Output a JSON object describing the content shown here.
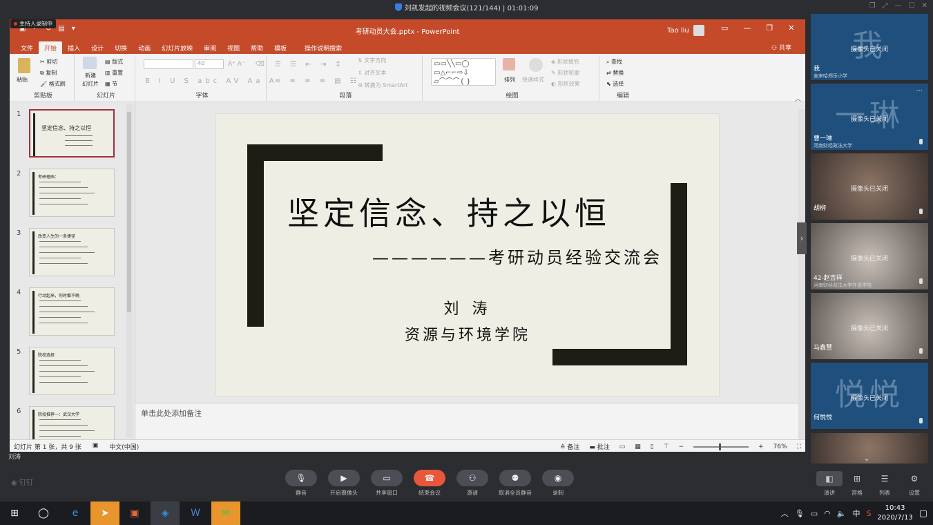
{
  "meeting": {
    "title": "刘凯发起的视频会议(121/144)  |  01:01:09",
    "recording_badge": "主持人录制中",
    "presenter_name": "刘涛"
  },
  "ppt": {
    "doc_title": "考研动员大会.pptx  -  PowerPoint",
    "user_name": "Tao liu",
    "share_label": "共享",
    "tabs": [
      "文件",
      "开始",
      "插入",
      "设计",
      "切换",
      "动画",
      "幻灯片放映",
      "审阅",
      "视图",
      "帮助",
      "模板",
      "操作说明搜索"
    ],
    "active_tab": "开始",
    "ribbon": {
      "clipboard": {
        "label": "剪贴板",
        "paste": "粘贴",
        "cut": "剪切",
        "copy": "复制",
        "format_painter": "格式刷"
      },
      "slides": {
        "label": "幻灯片",
        "new_slide": "新建\n幻灯片",
        "layout": "版式",
        "reset": "重置",
        "section": "节"
      },
      "font": {
        "label": "字体",
        "size": "40"
      },
      "paragraph": {
        "label": "段落",
        "text_direction": "文字方向",
        "align_text": "对齐文本",
        "smartart": "转换为 SmartArt"
      },
      "drawing": {
        "label": "绘图",
        "arrange": "排列",
        "quick_styles": "快速样式",
        "shape_fill": "形状填充",
        "shape_outline": "形状轮廓",
        "shape_effects": "形状效果"
      },
      "editing": {
        "label": "编辑",
        "find": "查找",
        "replace": "替换",
        "select": "选择"
      }
    },
    "thumbnails": [
      {
        "num": "1",
        "title": "坚定信念、持之以恒"
      },
      {
        "num": "2",
        "title": "考研理由："
      },
      {
        "num": "3",
        "title": "改变人生的一条捷径"
      },
      {
        "num": "4",
        "title": "行动起来，何时都不晚"
      },
      {
        "num": "5",
        "title": "院校选择"
      },
      {
        "num": "6",
        "title": "院校推荐一：武汉大学"
      }
    ],
    "slide": {
      "title": "坚定信念、持之以恒",
      "subtitle": "——————考研动员经验交流会",
      "author": "刘 涛",
      "institute": "资源与环境学院"
    },
    "notes_placeholder": "单击此处添加备注",
    "status": {
      "slide_info": "幻灯片 第 1 张，共 9 张",
      "language": "中文(中国)",
      "notes_btn": "备注",
      "comments_btn": "批注",
      "zoom": "76%"
    }
  },
  "participants": [
    {
      "big": "我",
      "cam": "摄像头已关闭",
      "name": "我",
      "org": "舍宋哈郑乐小学",
      "style": "blue"
    },
    {
      "big": "一琳",
      "cam": "摄像头已关闭",
      "name": "曹一琳",
      "org": "河南财经政法大学",
      "style": "blue"
    },
    {
      "big": "",
      "cam": "摄像头已关闭",
      "name": "胡柳",
      "org": "",
      "style": "photo"
    },
    {
      "big": "",
      "cam": "摄像头已关闭",
      "name": "42-赵吉祥",
      "org": "河南财经政法大学外语学院",
      "style": "photo2"
    },
    {
      "big": "",
      "cam": "摄像头已关闭",
      "name": "马鑫慧",
      "org": "",
      "style": "photo2"
    },
    {
      "big": "悦悦",
      "cam": "摄像头已关闭",
      "name": "何悦悦",
      "org": "",
      "style": "blue"
    }
  ],
  "toolbar": {
    "brand": "钉钉",
    "mute": "静音",
    "camera": "开启摄像头",
    "share": "共享窗口",
    "end": "结束会议",
    "invite": "邀请",
    "unmute_all": "取消全员静音",
    "record": "录制",
    "layout_speaker": "演讲",
    "layout_gallery": "宫格",
    "layout_list": "列表",
    "settings": "设置"
  },
  "taskbar": {
    "ime": "中",
    "time": "10:43",
    "date": "2020/7/13"
  }
}
